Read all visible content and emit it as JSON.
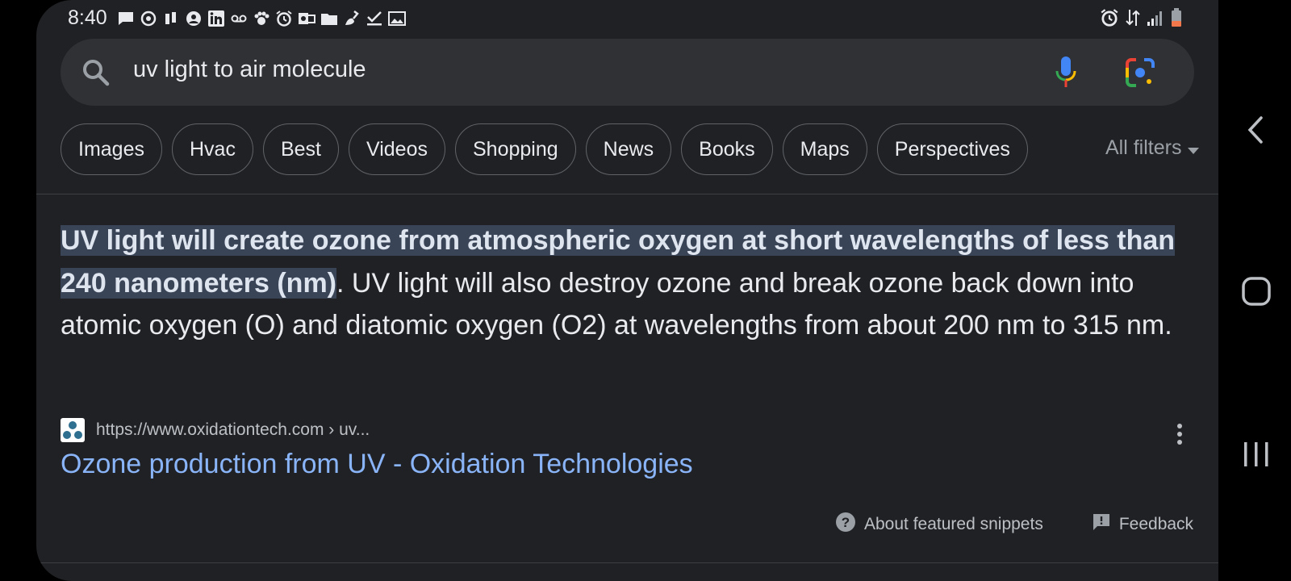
{
  "status_bar": {
    "time": "8:40",
    "left_icons": [
      "message-icon",
      "sync-icon",
      "app-icon",
      "account-icon",
      "linkedin-icon",
      "voicemail-icon",
      "paw-icon",
      "alarm-icon",
      "outlook-icon",
      "folder-icon",
      "cleaner-icon",
      "check-icon",
      "image-icon"
    ],
    "right_icons": [
      "alarm-icon",
      "data-icon",
      "signal-icon",
      "battery-low-icon"
    ]
  },
  "search": {
    "query": "uv light to air molecule",
    "icons": [
      "search-icon",
      "mic-icon",
      "lens-icon"
    ]
  },
  "chips": [
    "Images",
    "Hvac",
    "Best",
    "Videos",
    "Shopping",
    "News",
    "Books",
    "Maps",
    "Perspectives"
  ],
  "all_filters": "All filters",
  "snippet": {
    "highlight": "UV light will create ozone from atmospheric oxygen at short wavelengths of less than 240 nanometers (nm)",
    "rest": ". UV light will also destroy ozone and break ozone back down into atomic oxygen (O) and diatomic oxygen (O2) at wavelengths from about 200 nm to 315 nm."
  },
  "source": {
    "url": "https://www.oxidationtech.com › uv...",
    "title": "Ozone production from UV - Oxidation Technologies"
  },
  "footer": {
    "about": "About featured snippets",
    "feedback": "Feedback"
  },
  "colors": {
    "background": "#202124",
    "link": "#8ab4f8",
    "highlight": "#394457",
    "text": "#e8eaed"
  }
}
